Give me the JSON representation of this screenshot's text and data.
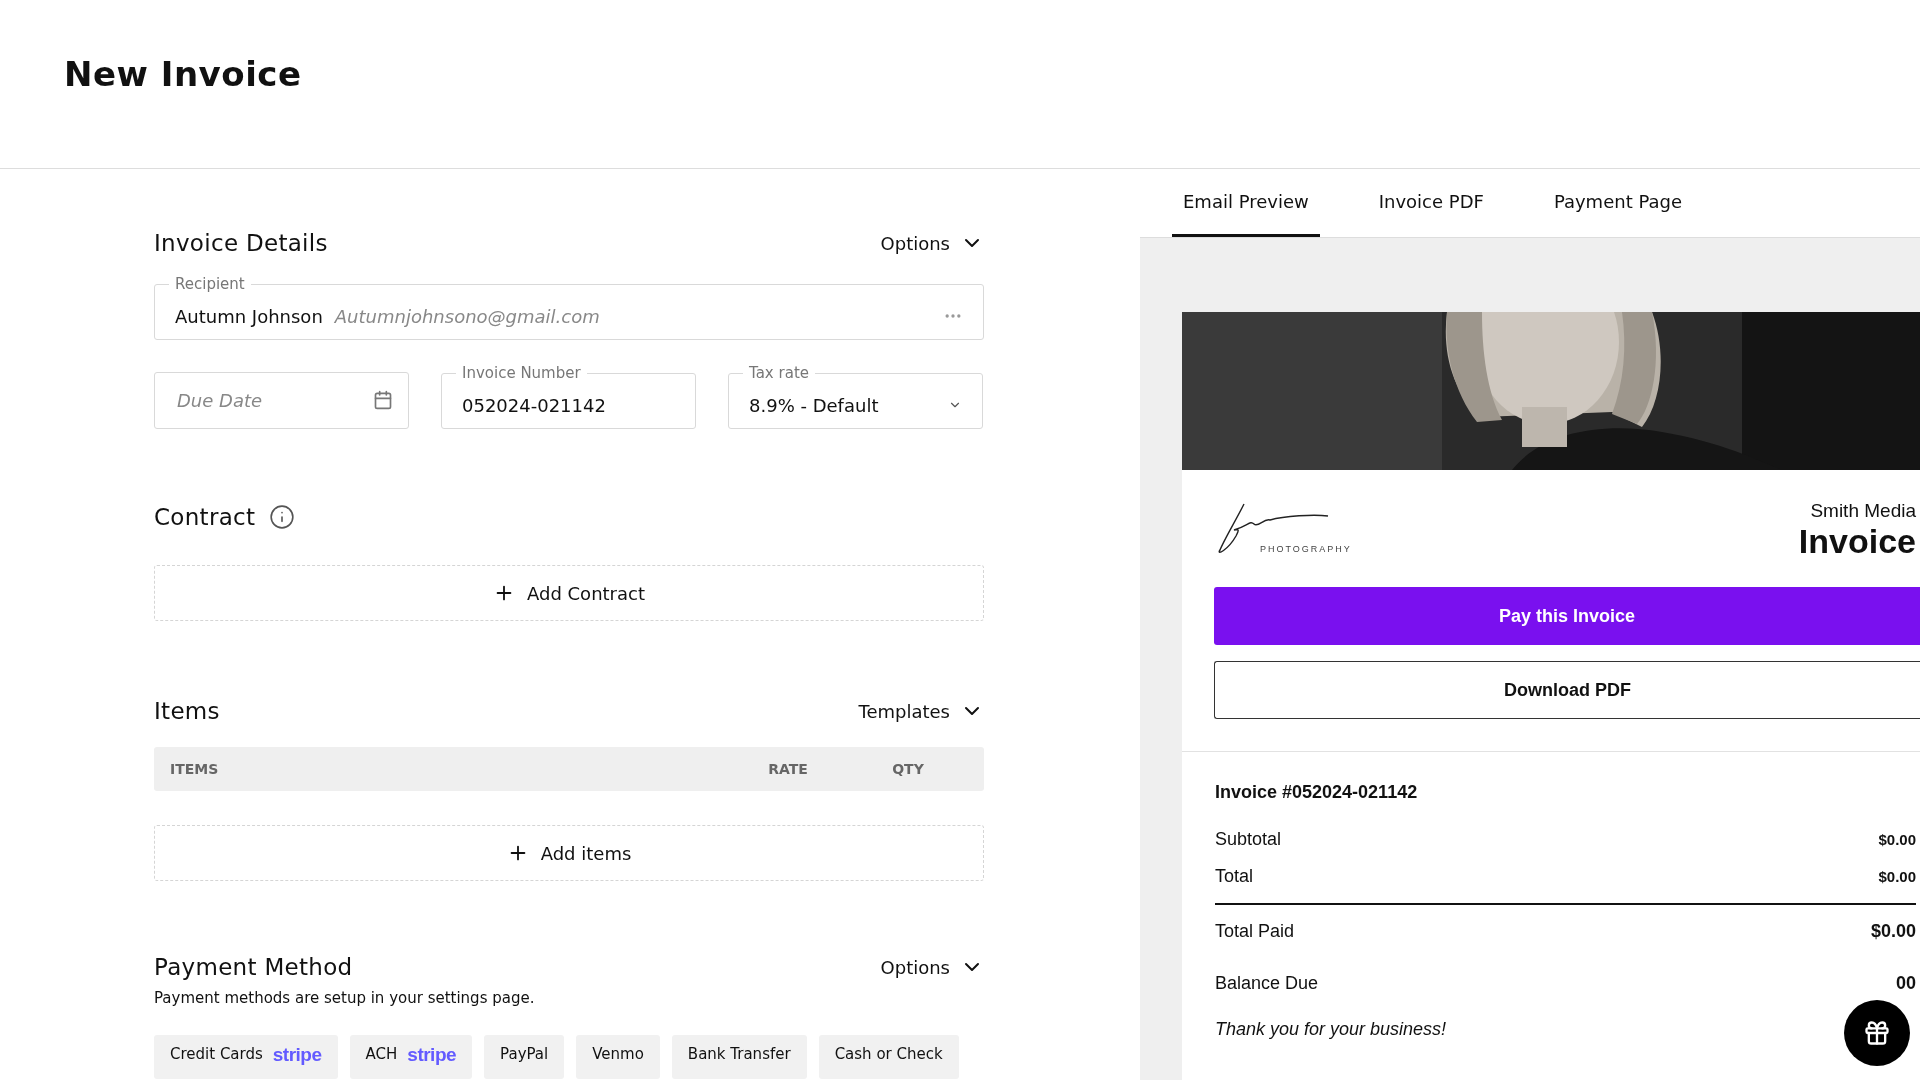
{
  "page": {
    "title": "New Invoice"
  },
  "invoice_details": {
    "title": "Invoice Details",
    "options_label": "Options",
    "recipient": {
      "label": "Recipient",
      "name": "Autumn Johnson",
      "email": "Autumnjohnsono@gmail.com"
    },
    "due_date": {
      "placeholder": "Due Date"
    },
    "invoice_number": {
      "label": "Invoice Number",
      "value": "052024-021142"
    },
    "tax_rate": {
      "label": "Tax rate",
      "value": "8.9% - Default"
    }
  },
  "contract": {
    "title": "Contract",
    "add_label": "Add Contract"
  },
  "items": {
    "title": "Items",
    "templates_label": "Templates",
    "columns": [
      "ITEMS",
      "RATE",
      "QTY"
    ],
    "add_label": "Add items"
  },
  "payment_method": {
    "title": "Payment Method",
    "options_label": "Options",
    "note": "Payment methods are setup in your settings page.",
    "methods": [
      {
        "label": "Credit Cards",
        "brand": "stripe"
      },
      {
        "label": "ACH",
        "brand": "stripe"
      },
      {
        "label": "PayPal"
      },
      {
        "label": "Venmo"
      },
      {
        "label": "Bank Transfer"
      },
      {
        "label": "Cash or Check"
      }
    ]
  },
  "preview_tabs": [
    {
      "label": "Email Preview",
      "selected": true
    },
    {
      "label": "Invoice PDF",
      "selected": false
    },
    {
      "label": "Payment Page",
      "selected": false
    }
  ],
  "email_preview": {
    "logo_tagline": "PHOTOGRAPHY",
    "company": "Smith Media",
    "doc_title": "Invoice",
    "pay_button": "Pay this Invoice",
    "download_button": "Download PDF",
    "invoice_ref": "Invoice #052024-021142",
    "totals": [
      {
        "label": "Subtotal",
        "value": "$0.00",
        "kind": "small"
      },
      {
        "label": "Total",
        "value": "$0.00",
        "kind": "small"
      },
      {
        "label": "Total Paid",
        "value": "$0.00",
        "kind": "large"
      },
      {
        "label": "Balance Due",
        "value": "00",
        "kind": "large"
      }
    ],
    "closing": "Thank you for your business!"
  }
}
